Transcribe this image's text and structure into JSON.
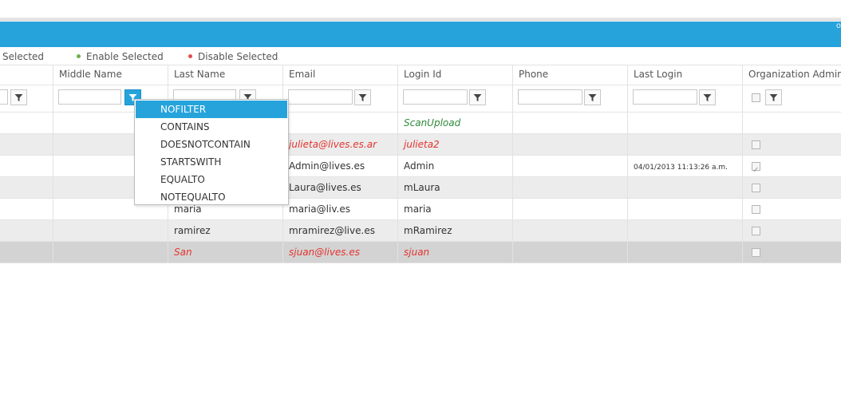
{
  "title_bar": {
    "corner_text": "o"
  },
  "toolbar": {
    "items": [
      {
        "label": "Selected"
      },
      {
        "label": "Enable Selected",
        "dot_color": "#6ab04c"
      },
      {
        "label": "Disable Selected",
        "dot_color": "#e14b4b"
      }
    ]
  },
  "columns": [
    "Middle Name",
    "Last Name",
    "Email",
    "Login Id",
    "Phone",
    "Last Login",
    "Organization Admin"
  ],
  "rows": [
    {
      "last_name": "",
      "email": "",
      "login_id": "ScanUpload",
      "last_login": "",
      "admin_checked": null,
      "style": "green"
    },
    {
      "last_name": "",
      "email": "julieta@lives.es.ar",
      "login_id": "julieta2",
      "last_login": "",
      "admin_checked": false,
      "style": "red"
    },
    {
      "last_name": "",
      "email": "Admin@lives.es",
      "login_id": "Admin",
      "last_login": "04/01/2013 11:13:26 a.m.",
      "admin_checked": true,
      "style": "normal"
    },
    {
      "last_name": "",
      "email": "Laura@lives.es",
      "login_id": "mLaura",
      "last_login": "",
      "admin_checked": false,
      "style": "normal"
    },
    {
      "last_name": "maria",
      "email": "maria@liv.es",
      "login_id": "maria",
      "last_login": "",
      "admin_checked": false,
      "style": "normal"
    },
    {
      "last_name": "ramirez",
      "email": "mramirez@live.es",
      "login_id": "mRamirez",
      "last_login": "",
      "admin_checked": false,
      "style": "normal"
    },
    {
      "last_name": "San",
      "email": "sjuan@lives.es",
      "login_id": "sjuan",
      "last_login": "",
      "admin_checked": false,
      "style": "red"
    }
  ],
  "filter_menu": {
    "selected": "NOFILTER",
    "options": [
      "NOFILTER",
      "CONTAINS",
      "DOESNOTCONTAIN",
      "STARTSWITH",
      "EQUALTO",
      "NOTEQUALTO"
    ]
  },
  "colors": {
    "accent": "#27a3dc",
    "error_text": "#e3342f",
    "system_text": "#2e8b3a"
  }
}
